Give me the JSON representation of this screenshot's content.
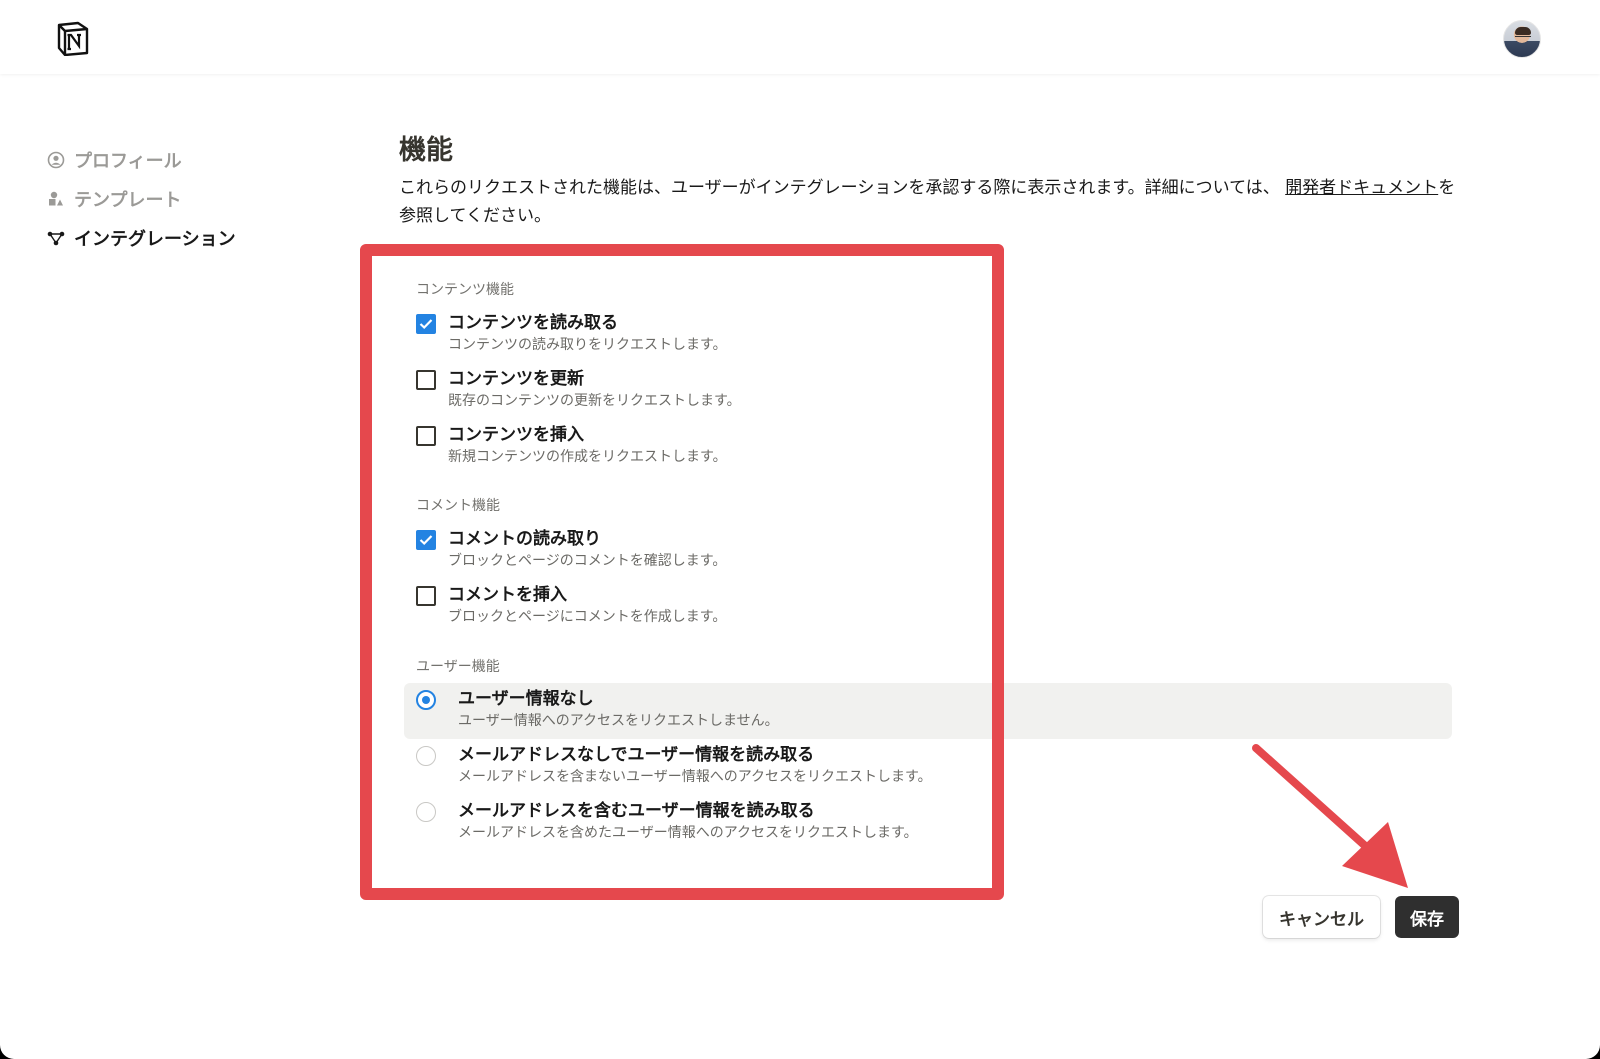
{
  "header": {
    "logo_icon": "notion-logo-icon",
    "avatar_icon": "user-avatar"
  },
  "sidebar": {
    "items": [
      {
        "label": "プロフィール",
        "icon": "profile-icon",
        "active": false
      },
      {
        "label": "テンプレート",
        "icon": "template-icon",
        "active": false
      },
      {
        "label": "インテグレーション",
        "icon": "integration-icon",
        "active": true
      }
    ]
  },
  "main": {
    "title": "機能",
    "description_prefix": "これらのリクエストされた機能は、ユーザーがインテグレーションを承認する際に表示されます。詳細については、",
    "description_link": "開発者ドキュメント",
    "description_suffix": "を参照してください。"
  },
  "content_section": {
    "label": "コンテンツ機能",
    "options": [
      {
        "title": "コンテンツを読み取る",
        "subtitle": "コンテンツの読み取りをリクエストします。",
        "checked": true
      },
      {
        "title": "コンテンツを更新",
        "subtitle": "既存のコンテンツの更新をリクエストします。",
        "checked": false
      },
      {
        "title": "コンテンツを挿入",
        "subtitle": "新規コンテンツの作成をリクエストします。",
        "checked": false
      }
    ]
  },
  "comment_section": {
    "label": "コメント機能",
    "options": [
      {
        "title": "コメントの読み取り",
        "subtitle": "ブロックとページのコメントを確認します。",
        "checked": true
      },
      {
        "title": "コメントを挿入",
        "subtitle": "ブロックとページにコメントを作成します。",
        "checked": false
      }
    ]
  },
  "user_section": {
    "label": "ユーザー機能",
    "options": [
      {
        "title": "ユーザー情報なし",
        "subtitle": "ユーザー情報へのアクセスをリクエストしません。",
        "selected": true
      },
      {
        "title": "メールアドレスなしでユーザー情報を読み取る",
        "subtitle": "メールアドレスを含まないユーザー情報へのアクセスをリクエストします。",
        "selected": false
      },
      {
        "title": "メールアドレスを含むユーザー情報を読み取る",
        "subtitle": "メールアドレスを含めたユーザー情報へのアクセスをリクエストします。",
        "selected": false
      }
    ]
  },
  "actions": {
    "cancel_label": "キャンセル",
    "save_label": "保存"
  },
  "colors": {
    "accent": "#2383e2",
    "highlight_border": "#e5484d",
    "save_button": "#2f2f2f"
  }
}
